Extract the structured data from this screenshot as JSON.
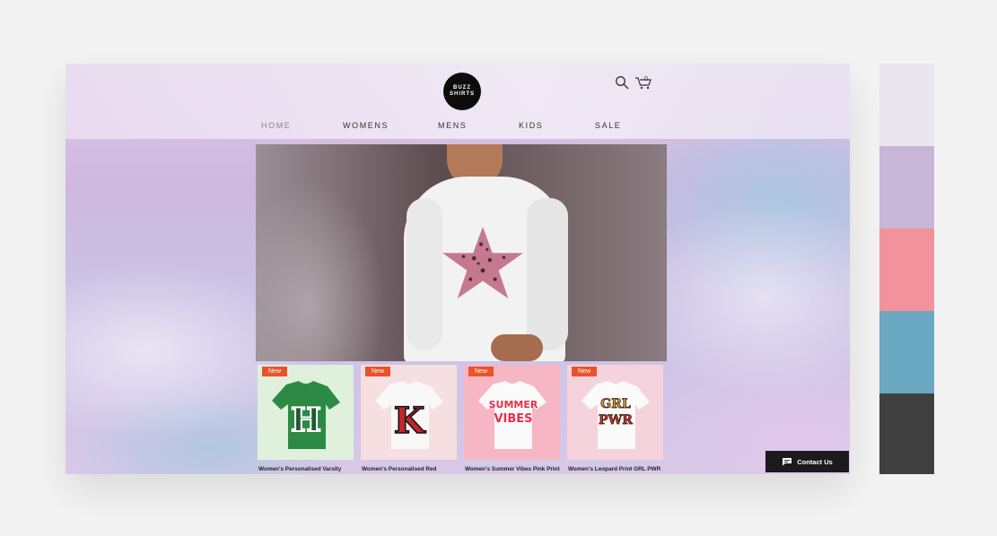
{
  "brand": {
    "logo_line1": "BUZZ",
    "logo_line2": "SHIRTS"
  },
  "header": {
    "cart_count": "0"
  },
  "nav": [
    {
      "label": "HOME",
      "active": true
    },
    {
      "label": "WOMENS"
    },
    {
      "label": "MENS"
    },
    {
      "label": "KIDS"
    },
    {
      "label": "SALE"
    }
  ],
  "products": [
    {
      "badge": "New",
      "title": "Women's Personalised Varsity",
      "bg": "#dff0dc",
      "tee_color": "#2d8a45",
      "print": "H"
    },
    {
      "badge": "New",
      "title": "Women's Personalised Red",
      "bg": "#f6dfe0",
      "tee_color": "#f5f5f5",
      "print": "K"
    },
    {
      "badge": "New",
      "title": "Women's Summer Vibes Pink Print",
      "bg": "#f6b6c3",
      "tee_color": "#fafafa",
      "print": "SUMMER VIBES"
    },
    {
      "badge": "New",
      "title": "Women's Leopard Print GRL PWR",
      "bg": "#f4d3dc",
      "tee_color": "#fafafa",
      "print": "GRL PWR"
    }
  ],
  "contact": {
    "label": "Contact Us"
  },
  "palette": [
    "#ebe5f0",
    "#c7b6d8",
    "#f3929c",
    "#6aa7c1",
    "#404040"
  ],
  "colors": {
    "accent_badge": "#e8532b",
    "logo_bg": "#0c0c0c"
  }
}
